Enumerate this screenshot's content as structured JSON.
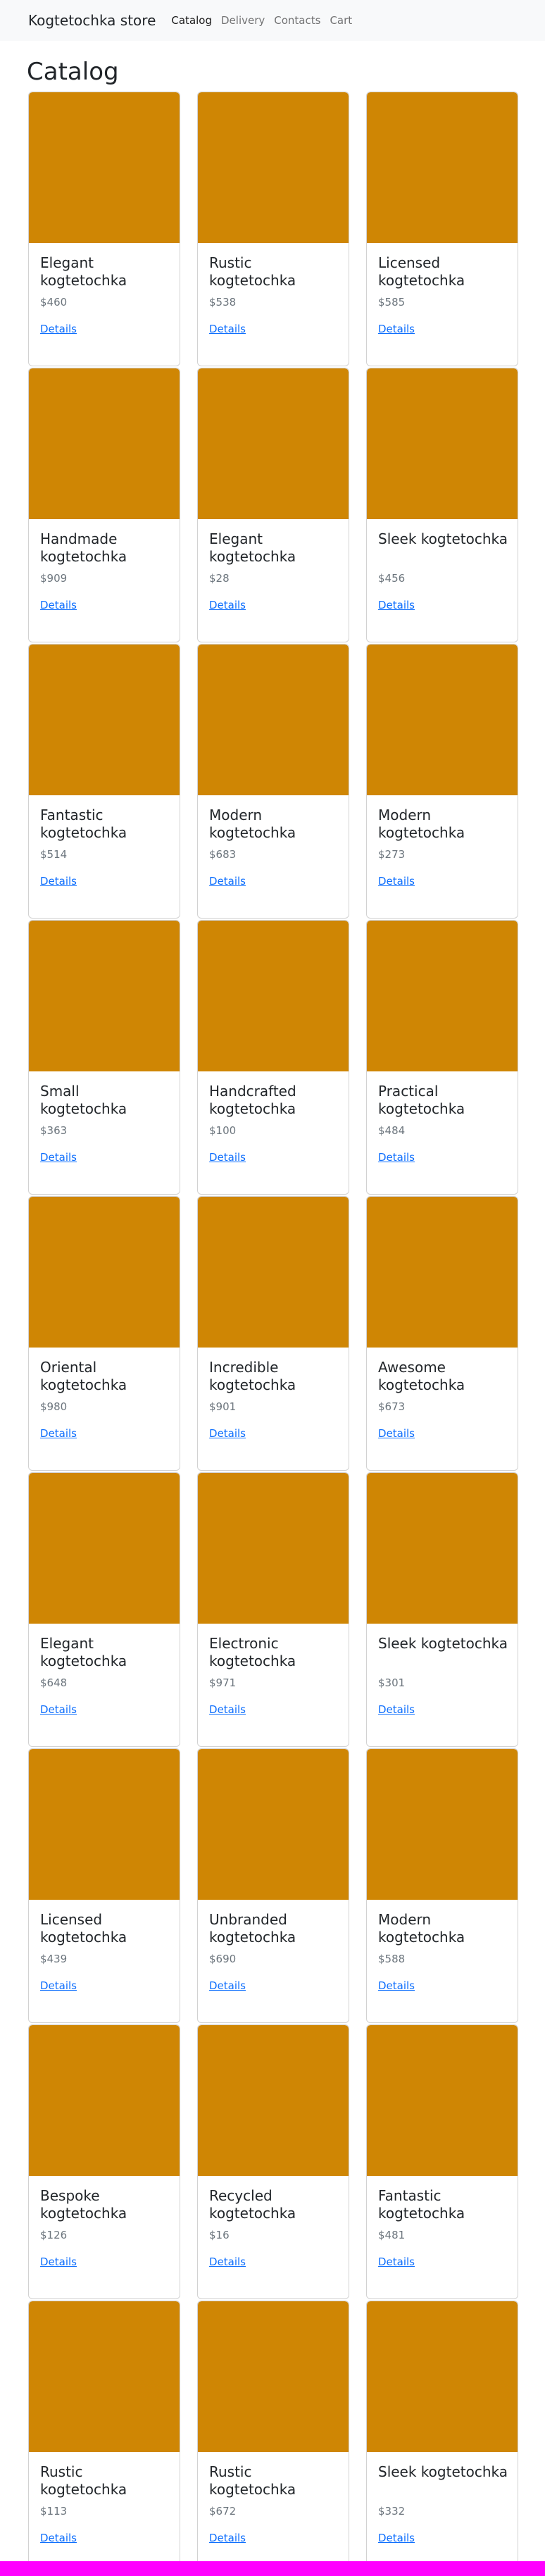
{
  "navbar": {
    "brand": "Kogtetochka store",
    "links": [
      {
        "label": "Catalog",
        "active": true
      },
      {
        "label": "Delivery",
        "active": false
      },
      {
        "label": "Contacts",
        "active": false
      },
      {
        "label": "Cart",
        "active": false
      }
    ]
  },
  "page": {
    "title": "Catalog"
  },
  "colors": {
    "card_image": "#cf8604",
    "link": "#0d6efd",
    "footer_bar": "#ff00ff"
  },
  "products": [
    {
      "name": "Elegant kogtetochka",
      "price": "$460",
      "link": "Details"
    },
    {
      "name": "Rustic kogtetochka",
      "price": "$538",
      "link": "Details"
    },
    {
      "name": "Licensed kogtetochka",
      "price": "$585",
      "link": "Details"
    },
    {
      "name": "Handmade kogtetochka",
      "price": "$909",
      "link": "Details"
    },
    {
      "name": "Elegant kogtetochka",
      "price": "$28",
      "link": "Details"
    },
    {
      "name": "Sleek kogtetochka",
      "price": "$456",
      "link": "Details"
    },
    {
      "name": "Fantastic kogtetochka",
      "price": "$514",
      "link": "Details"
    },
    {
      "name": "Modern kogtetochka",
      "price": "$683",
      "link": "Details"
    },
    {
      "name": "Modern kogtetochka",
      "price": "$273",
      "link": "Details"
    },
    {
      "name": "Small kogtetochka",
      "price": "$363",
      "link": "Details"
    },
    {
      "name": "Handcrafted kogtetochka",
      "price": "$100",
      "link": "Details"
    },
    {
      "name": "Practical kogtetochka",
      "price": "$484",
      "link": "Details"
    },
    {
      "name": "Oriental kogtetochka",
      "price": "$980",
      "link": "Details"
    },
    {
      "name": "Incredible kogtetochka",
      "price": "$901",
      "link": "Details"
    },
    {
      "name": "Awesome kogtetochka",
      "price": "$673",
      "link": "Details"
    },
    {
      "name": "Elegant kogtetochka",
      "price": "$648",
      "link": "Details"
    },
    {
      "name": "Electronic kogtetochka",
      "price": "$971",
      "link": "Details"
    },
    {
      "name": "Sleek kogtetochka",
      "price": "$301",
      "link": "Details"
    },
    {
      "name": "Licensed kogtetochka",
      "price": "$439",
      "link": "Details"
    },
    {
      "name": "Unbranded kogtetochka",
      "price": "$690",
      "link": "Details"
    },
    {
      "name": "Modern kogtetochka",
      "price": "$588",
      "link": "Details"
    },
    {
      "name": "Bespoke kogtetochka",
      "price": "$126",
      "link": "Details"
    },
    {
      "name": "Recycled kogtetochka",
      "price": "$16",
      "link": "Details"
    },
    {
      "name": "Fantastic kogtetochka",
      "price": "$481",
      "link": "Details"
    },
    {
      "name": "Rustic kogtetochka",
      "price": "$113",
      "link": "Details"
    },
    {
      "name": "Rustic kogtetochka",
      "price": "$672",
      "link": "Details"
    },
    {
      "name": "Sleek kogtetochka",
      "price": "$332",
      "link": "Details"
    }
  ]
}
